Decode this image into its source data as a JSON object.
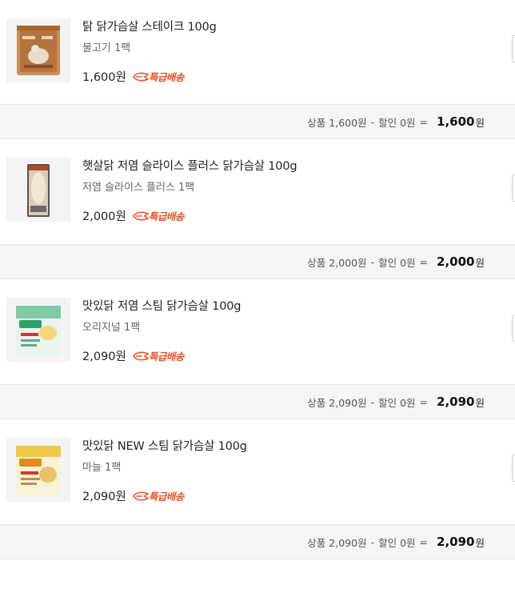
{
  "items": [
    {
      "title": "탉 닭가슴살 스테이크 100g",
      "option": "불고기 1팩",
      "price": "1,600원",
      "badge": "특급배송",
      "summary": {
        "product_label": "상품",
        "product_amount": "1,600원",
        "minus": "-",
        "discount_label": "할인",
        "discount_amount": "0원",
        "equals": "=",
        "total": "1,600",
        "total_unit": "원"
      }
    },
    {
      "title": "햇살닭 저염 슬라이스 플러스 닭가슴살 100g",
      "option": "저염 슬라이스 플러스 1팩",
      "price": "2,000원",
      "badge": "특급배송",
      "summary": {
        "product_label": "상품",
        "product_amount": "2,000원",
        "minus": "-",
        "discount_label": "할인",
        "discount_amount": "0원",
        "equals": "=",
        "total": "2,000",
        "total_unit": "원"
      }
    },
    {
      "title": "맛있닭 저염 스팀 닭가슴살 100g",
      "option": "오리지널 1팩",
      "price": "2,090원",
      "badge": "특급배송",
      "summary": {
        "product_label": "상품",
        "product_amount": "2,090원",
        "minus": "-",
        "discount_label": "할인",
        "discount_amount": "0원",
        "equals": "=",
        "total": "2,090",
        "total_unit": "원"
      }
    },
    {
      "title": "맛있닭 NEW 스팀 닭가슴살 100g",
      "option": "마늘 1팩",
      "price": "2,090원",
      "badge": "특급배송",
      "summary": {
        "product_label": "상품",
        "product_amount": "2,090원",
        "minus": "-",
        "discount_label": "할인",
        "discount_amount": "0원",
        "equals": "=",
        "total": "2,090",
        "total_unit": "원"
      }
    }
  ],
  "colors": {
    "badge": "#ef4f25",
    "summary_bg": "#f5f5f5"
  },
  "icons": {
    "badge": "rocket-delivery-icon"
  }
}
